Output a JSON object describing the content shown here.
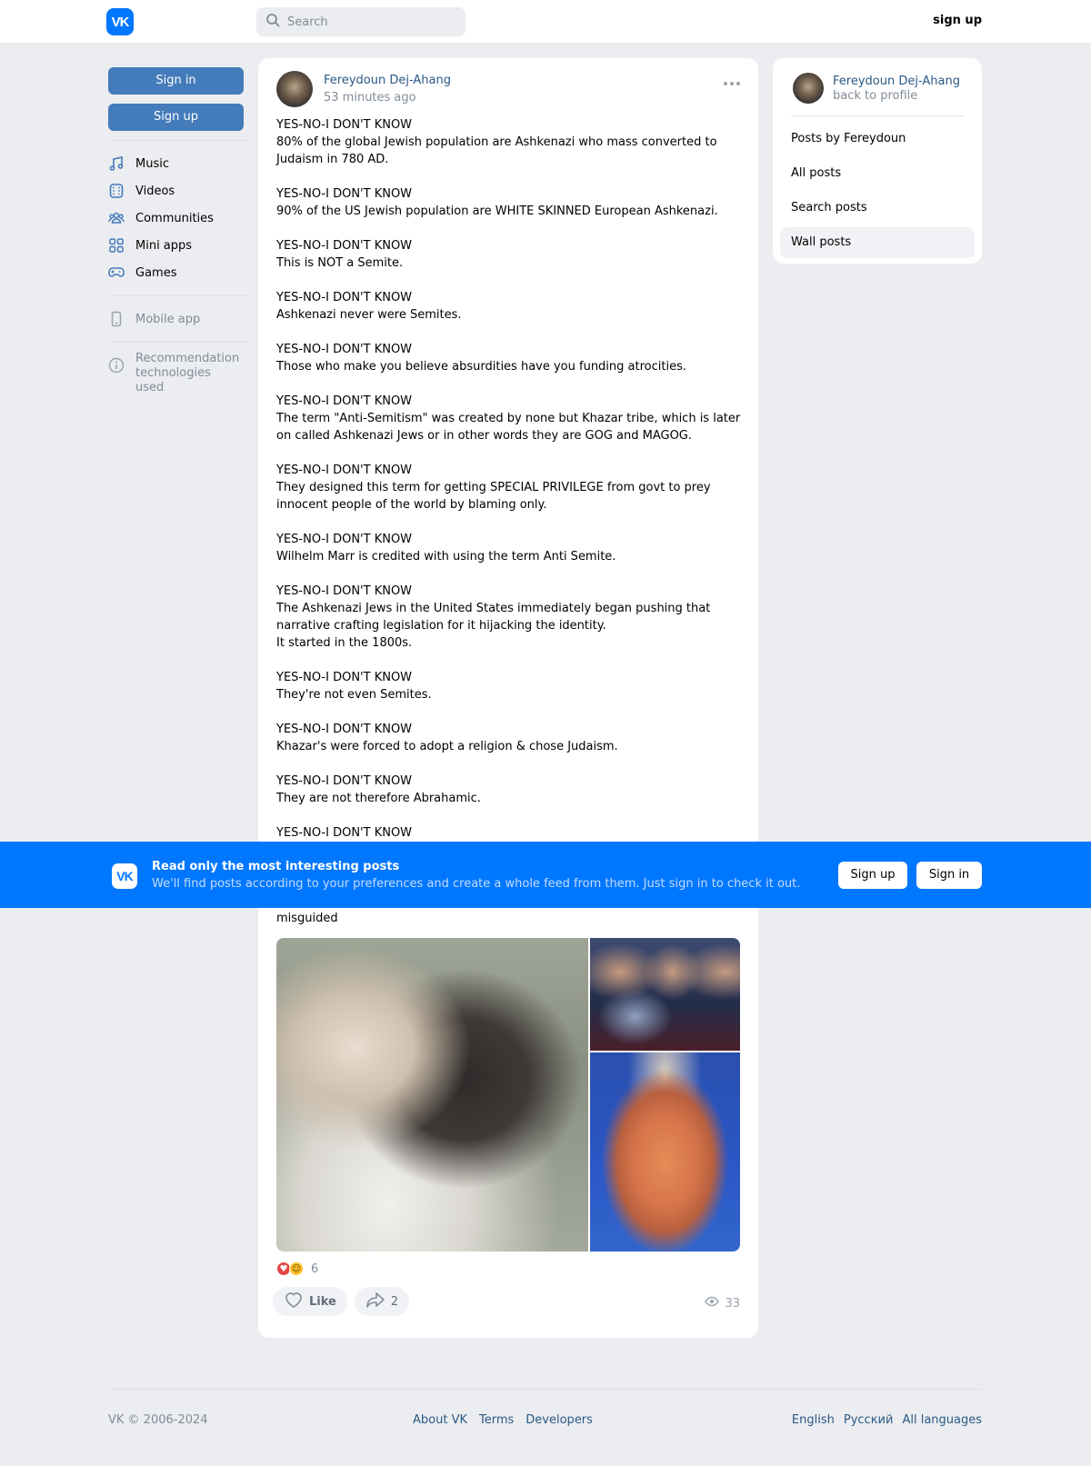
{
  "header": {
    "logo_text": "VK",
    "search_placeholder": "Search",
    "signup_label": "sign up"
  },
  "leftnav": {
    "signin_label": "Sign in",
    "signup_label": "Sign up",
    "items": [
      {
        "label": "Music",
        "icon": "music-icon"
      },
      {
        "label": "Videos",
        "icon": "video-icon"
      },
      {
        "label": "Communities",
        "icon": "communities-icon"
      },
      {
        "label": "Mini apps",
        "icon": "mini-apps-icon"
      },
      {
        "label": "Games",
        "icon": "gamepad-icon"
      }
    ],
    "mobile_app": "Mobile app",
    "recommendation": "Recommendation technologies used"
  },
  "post": {
    "author": "Fereydoun Dej-Ahang",
    "time": "53 minutes ago",
    "text": "YES-NO-I DON'T KNOW\n80% of the global Jewish population are Ashkenazi who mass converted to Judaism in 780 AD.\n\nYES-NO-I DON'T KNOW\n90% of the US Jewish population are WHITE SKINNED European Ashkenazi.\n\nYES-NO-I DON'T KNOW\nThis is NOT a Semite.\n\nYES-NO-I DON'T KNOW\nAshkenazi never were Semites.\n\nYES-NO-I DON'T KNOW\nThose who make you believe absurdities have you funding atrocities.\n\nYES-NO-I DON'T KNOW\nThe term \"Anti-Semitism\" was created by none but Khazar tribe, which is later on called Ashkenazi Jews or in other words they are GOG and MAGOG.\n\nYES-NO-I DON'T KNOW\nThey designed this term for getting SPECIAL PRIVILEGE from govt to prey innocent people of the world by blaming only.\n\nYES-NO-I DON'T KNOW\nWilhelm Marr is credited with using the term Anti Semite.\n\nYES-NO-I DON'T KNOW\nThe Ashkenazi Jews in the United States immediately began pushing that narrative crafting legislation for it hijacking the identity.\nIt started in the 1800s.\n\nYES-NO-I DON'T KNOW\nThey're not even Semites.\n\nYES-NO-I DON'T KNOW\nKhazar's were forced to adopt a religion & chose Judaism.\n\nYES-NO-I DON'T KNOW\nThey are not therefore Abrahamic.\n\nYES-NO-I DON'T KNOW",
    "text_tail": "misguided",
    "reactions_count": "6",
    "like_label": "Like",
    "share_count": "2",
    "views_count": "33"
  },
  "rightpanel": {
    "name": "Fereydoun Dej-Ahang",
    "back": "back to profile",
    "items": [
      {
        "label": "Posts by Fereydoun"
      },
      {
        "label": "All posts"
      },
      {
        "label": "Search posts"
      },
      {
        "label": "Wall posts"
      }
    ]
  },
  "banner": {
    "title": "Read only the most interesting posts",
    "subtitle": "We'll find posts according to your preferences and create a whole feed from them. Just sign in to check it out.",
    "signup_label": "Sign up",
    "signin_label": "Sign in"
  },
  "footer": {
    "copyright": "VK © 2006-2024",
    "links": [
      "About VK",
      "Terms",
      "Developers"
    ],
    "langs": [
      "English",
      "Русский",
      "All languages"
    ]
  },
  "colors": {
    "accent": "#0077ff",
    "button_blue": "#447bba",
    "link": "#2a5885",
    "background": "#ebedf0"
  }
}
